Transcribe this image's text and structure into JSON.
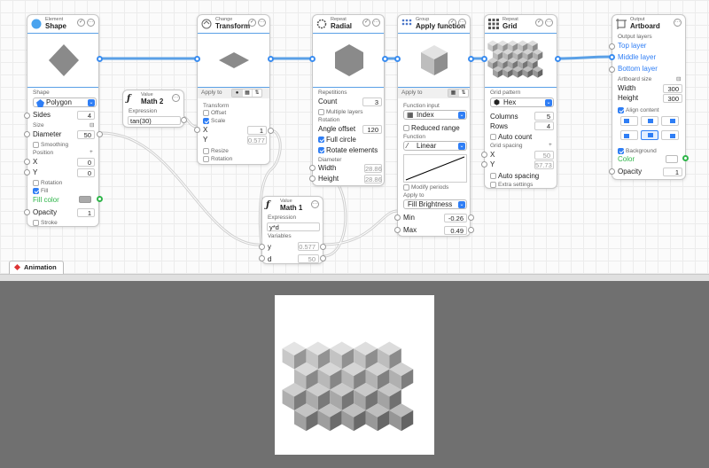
{
  "nodes": {
    "shape": {
      "category": "Element",
      "title": "Shape",
      "section": "Shape",
      "shape_type": "Polygon",
      "sides_label": "Sides",
      "sides": "4",
      "size_label": "Size",
      "diameter_label": "Diameter",
      "diameter": "50",
      "smoothing_label": "Smoothing",
      "position_label": "Position",
      "x_label": "X",
      "x": "0",
      "y_label": "Y",
      "y": "0",
      "rotation_label": "Rotation",
      "fill_label": "Fill",
      "fill_color_label": "Fill color",
      "opacity_label": "Opacity",
      "opacity": "1",
      "stroke_label": "Stroke"
    },
    "math2": {
      "category": "Value",
      "title": "Math 2",
      "expression_label": "Expression",
      "expression": "tan(30)"
    },
    "transform": {
      "category": "Change",
      "title": "Transform",
      "apply_to": "Apply to",
      "section": "Transform",
      "offset_label": "Offset",
      "scale_label": "Scale",
      "x_label": "X",
      "x": "1",
      "y_label": "Y",
      "y": "0.577",
      "resize_label": "Resize",
      "rotation_label": "Rotation"
    },
    "math1": {
      "category": "Value",
      "title": "Math 1",
      "expression_label": "Expression",
      "expression": "y*d",
      "variables_label": "Variables",
      "y_label": "y",
      "y": "0.577",
      "d_label": "d",
      "d": "50"
    },
    "radial": {
      "category": "Repeat",
      "title": "Radial",
      "repetitions_label": "Repetitions",
      "count_label": "Count",
      "count": "3",
      "multiple_layers_label": "Multiple layers",
      "rotation_label": "Rotation",
      "angle_offset_label": "Angle offset",
      "angle_offset": "120",
      "full_circle_label": "Full circle",
      "rotate_elements_label": "Rotate elements",
      "diameter_label": "Diameter",
      "width_label": "Width",
      "width": "28.86",
      "height_label": "Height",
      "height": "28.86"
    },
    "apply": {
      "category": "Group",
      "title": "Apply function",
      "apply_to": "Apply to",
      "function_input_label": "Function input",
      "input_value": "Index",
      "reduced_range_label": "Reduced range",
      "function_label": "Function",
      "function_value": "Linear",
      "modify_periods_label": "Modify periods",
      "apply_to2_label": "Apply to",
      "apply_to_value": "Fill Brightness",
      "min_label": "Min",
      "min": "-0.26",
      "max_label": "Max",
      "max": "0.49"
    },
    "grid": {
      "category": "Repeat",
      "title": "Grid",
      "pattern_label": "Grid pattern",
      "pattern": "Hex",
      "columns_label": "Columns",
      "columns": "5",
      "rows_label": "Rows",
      "rows": "4",
      "auto_count_label": "Auto count",
      "spacing_label": "Grid spacing",
      "x_label": "X",
      "x": "50",
      "y_label": "Y",
      "y": "57.73",
      "auto_spacing_label": "Auto spacing",
      "extra_settings_label": "Extra settings"
    },
    "artboard": {
      "category": "Output",
      "title": "Artboard",
      "output_layers_label": "Output layers",
      "top_layer": "Top layer",
      "middle_layer": "Middle layer",
      "bottom_layer": "Bottom layer",
      "size_label": "Artboard size",
      "width_label": "Width",
      "width": "300",
      "height_label": "Height",
      "height": "300",
      "align_label": "Align content",
      "background_label": "Background",
      "color_label": "Color",
      "opacity_label": "Opacity",
      "opacity": "1"
    }
  },
  "tabs": {
    "animation": "Animation"
  },
  "colors": {
    "accent": "#2f7ef5",
    "wire": "#5aa0e6",
    "port_green": "#2fb54a",
    "viewer_bg": "#707070"
  }
}
